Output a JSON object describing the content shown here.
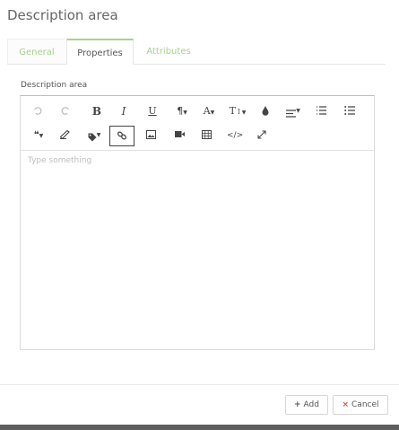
{
  "dialog": {
    "title": "Description area"
  },
  "tabs": [
    {
      "label": "General"
    },
    {
      "label": "Properties"
    },
    {
      "label": "Attributes"
    }
  ],
  "active_tab": "Properties",
  "field": {
    "label": "Description area",
    "placeholder": "Type something"
  },
  "toolbar": {
    "bold": "B",
    "italic": "I",
    "underline": "U",
    "paragraph": "¶",
    "font_color": "A",
    "text_size": "T",
    "active_tool": "link"
  },
  "footer": {
    "add_label": "Add",
    "add_icon": "+",
    "cancel_label": "Cancel",
    "cancel_icon": "×"
  },
  "colors": {
    "accent": "#a6d48a",
    "cancel_icon": "#d9534f",
    "bottom_bar": "#5e5e5e"
  }
}
